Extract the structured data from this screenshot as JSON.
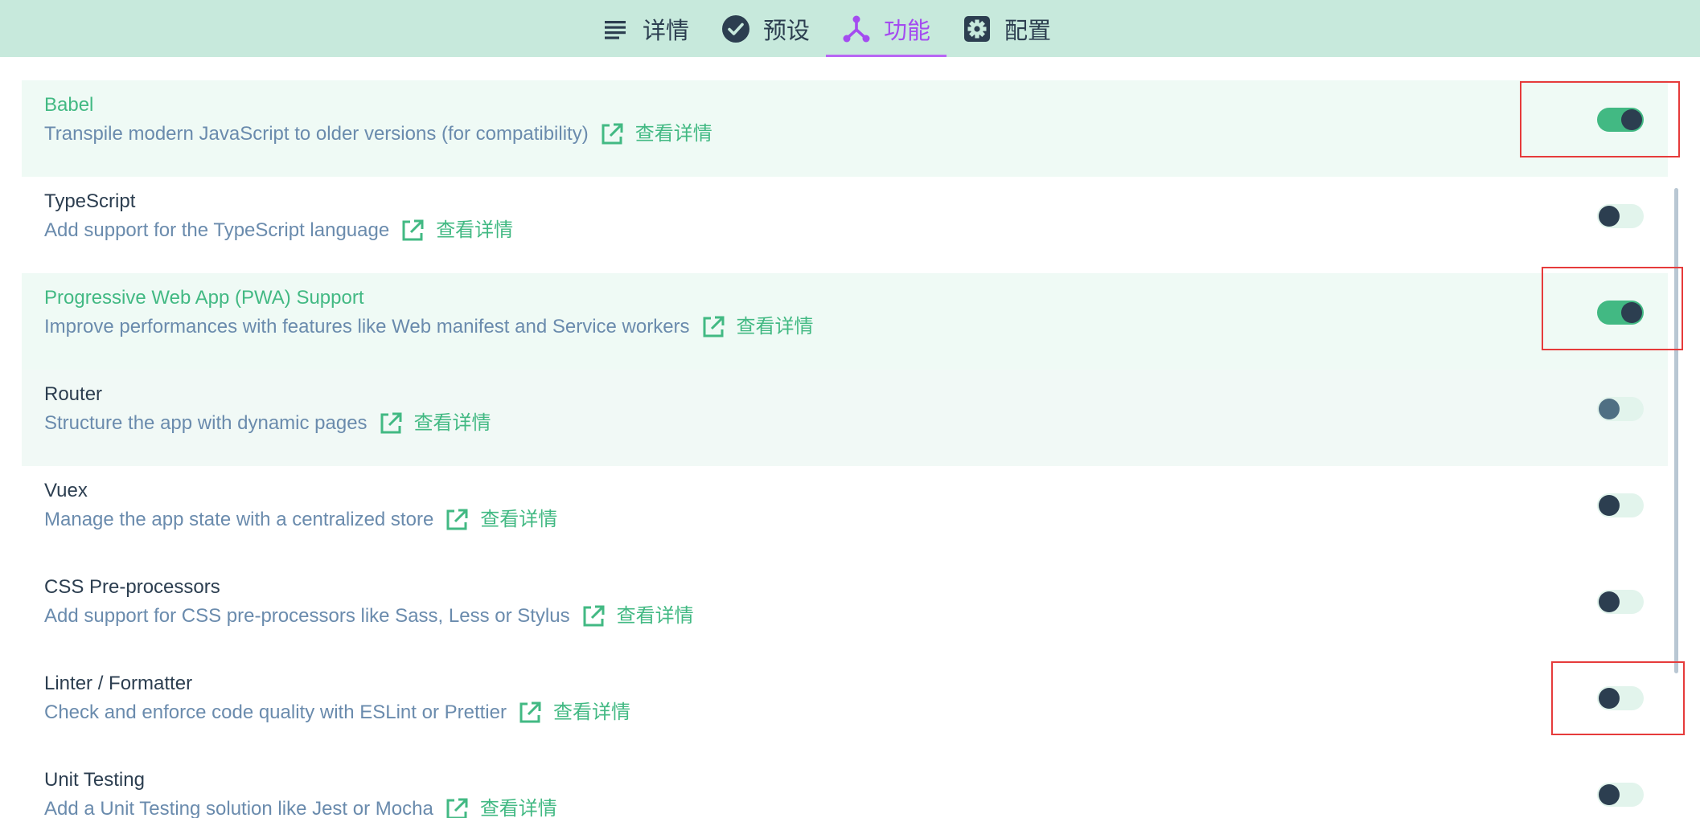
{
  "tabs": [
    {
      "label": "详情",
      "icon": "list-icon"
    },
    {
      "label": "预设",
      "icon": "check-circle-icon"
    },
    {
      "label": "功能",
      "icon": "fork-icon"
    },
    {
      "label": "配置",
      "icon": "gear-icon"
    }
  ],
  "active_tab": "功能",
  "details_link_label": "查看详情",
  "features": [
    {
      "name": "Babel",
      "description": "Transpile modern JavaScript to older versions (for compatibility)",
      "enabled": true
    },
    {
      "name": "TypeScript",
      "description": "Add support for the TypeScript language",
      "enabled": false
    },
    {
      "name": "Progressive Web App (PWA) Support",
      "description": "Improve performances with features like Web manifest and Service workers",
      "enabled": true
    },
    {
      "name": "Router",
      "description": "Structure the app with dynamic pages",
      "enabled": false
    },
    {
      "name": "Vuex",
      "description": "Manage the app state with a centralized store",
      "enabled": false
    },
    {
      "name": "CSS Pre-processors",
      "description": "Add support for CSS pre-processors like Sass, Less or Stylus",
      "enabled": false
    },
    {
      "name": "Linter / Formatter",
      "description": "Check and enforce code quality with ESLint or Prettier",
      "enabled": false
    },
    {
      "name": "Unit Testing",
      "description": "Add a Unit Testing solution like Jest or Mocha",
      "enabled": false
    }
  ],
  "colors": {
    "accent": "#42b983",
    "active_tab": "#a44cf0",
    "header_bg": "#c7e9dc",
    "highlight_box": "#e63b3b"
  }
}
